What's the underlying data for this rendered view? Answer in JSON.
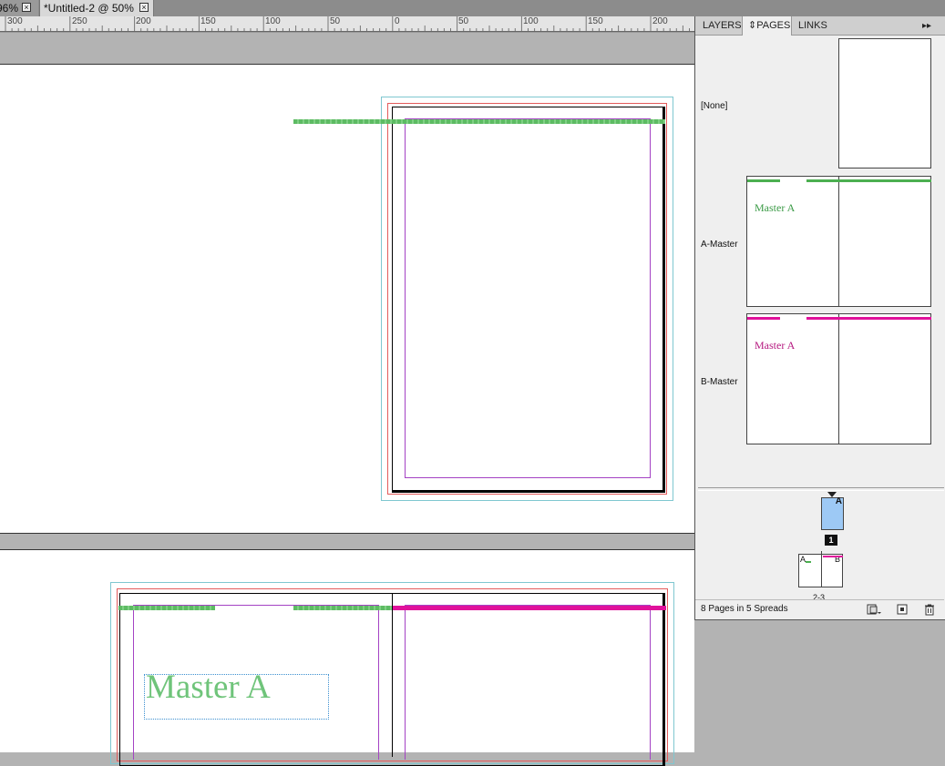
{
  "tabs": [
    {
      "label": "96%",
      "close": "×"
    },
    {
      "label": "*Untitled-2 @ 50%",
      "close": "×"
    }
  ],
  "ruler": {
    "labels": [
      "300",
      "250",
      "200",
      "150",
      "100",
      "50",
      "0",
      "50",
      "100",
      "150",
      "200"
    ]
  },
  "canvas": {
    "master_text": "Master A"
  },
  "panel": {
    "tabs": [
      {
        "label": "LAYERS"
      },
      {
        "label": "PAGES",
        "icon": "updown-arrows-icon"
      },
      {
        "label": "LINKS"
      }
    ],
    "menu_glyph": "▸▸",
    "masters": [
      {
        "label": "[None]"
      },
      {
        "label": "A-Master",
        "thumb_text": "Master A",
        "color": "#4caf50"
      },
      {
        "label": "B-Master",
        "thumb_text": "Master A",
        "color": "#e0119b"
      }
    ],
    "pages": [
      {
        "prefix": "A",
        "number": "1"
      },
      {
        "left_prefix": "A",
        "right_prefix": "B",
        "label": "2-3"
      }
    ],
    "footer": "8 Pages in 5 Spreads",
    "buttons": [
      "page-size-icon",
      "new-page-icon",
      "trash-icon"
    ]
  },
  "colors": {
    "green": "#5dbb63",
    "magenta": "#e0119b",
    "page_selected": "#9dc9f5"
  }
}
